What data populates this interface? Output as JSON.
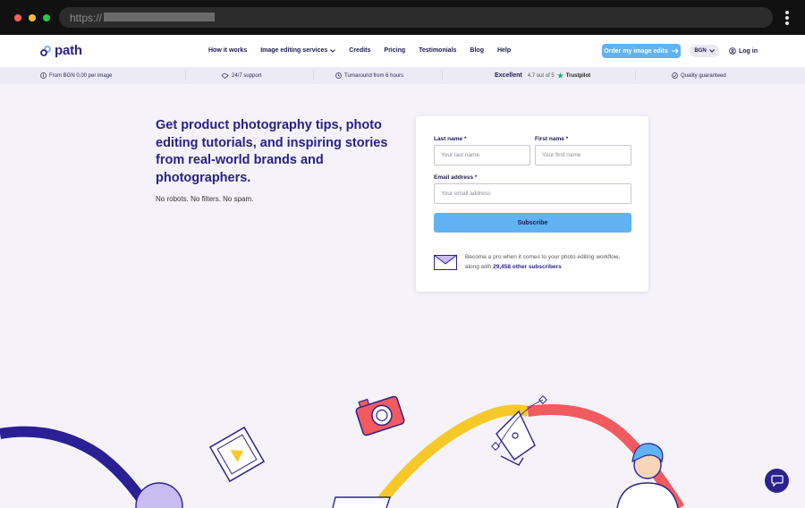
{
  "browser": {
    "url_prefix": "https://"
  },
  "header": {
    "logo_text": "path",
    "nav": [
      {
        "label": "How it works"
      },
      {
        "label": "Image editing services",
        "has_dropdown": true
      },
      {
        "label": "Credits"
      },
      {
        "label": "Pricing"
      },
      {
        "label": "Testimonials"
      },
      {
        "label": "Blog"
      },
      {
        "label": "Help"
      }
    ],
    "order_button": "Order my image edits",
    "currency": "BGN",
    "login": "Log in"
  },
  "infobar": {
    "price": "From BGN 0.00 per image",
    "support": "24/7 support",
    "turnaround": "Turnaround from 6 hours",
    "rating_word": "Excellent",
    "rating_value": "4.7 out of 5",
    "trustpilot": "Trustpilot",
    "quality": "Quality guaranteed"
  },
  "hero": {
    "headline": "Get product photography tips, photo editing tutorials, and inspiring stories from real-world brands and photographers.",
    "subline": "No robots. No filters. No spam."
  },
  "form": {
    "last_name_label": "Last name *",
    "last_name_placeholder": "Your last name",
    "first_name_label": "First name *",
    "first_name_placeholder": "Your first name",
    "email_label": "Email address *",
    "email_placeholder": "Your email address",
    "subscribe": "Subscribe",
    "pro_text": "Become a pro when it comes to your photo editing workflow, along with",
    "subscribers": "29,458 other subscribers"
  },
  "colors": {
    "brand": "#2a238f",
    "accent": "#61b2f2",
    "yellow": "#f7c928",
    "red": "#f25a5f"
  },
  "icons": [
    "coin-icon",
    "support-icon",
    "clock-icon",
    "trustpilot-star-icon",
    "shield-icon",
    "user-icon",
    "arrow-right-icon",
    "chevron-down-icon",
    "envelope-icon",
    "chat-icon"
  ]
}
